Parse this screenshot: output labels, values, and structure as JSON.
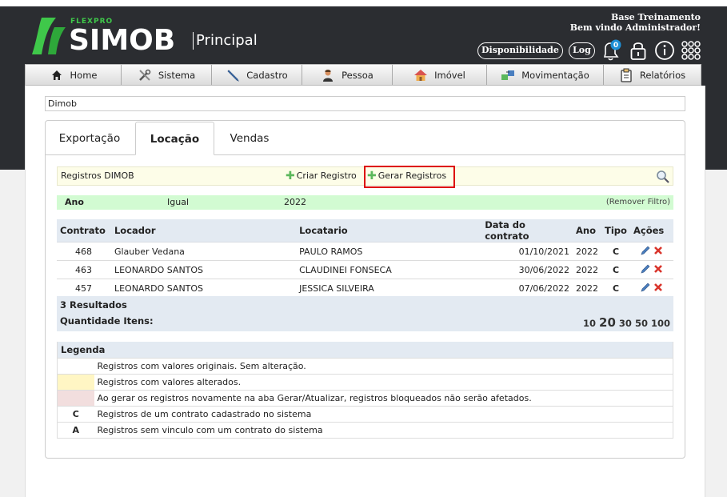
{
  "brand": {
    "flexpro": "FLEXPRO",
    "simob": "SIMOB",
    "section": "Principal"
  },
  "user": {
    "org": "Base Treinamento",
    "welcome": "Bem vindo Administrador!"
  },
  "topbar": {
    "disponibilidade": "Disponibilidade",
    "log": "Log",
    "notification_count": "0"
  },
  "menu": [
    {
      "label": "Home",
      "icon": "home-icon"
    },
    {
      "label": "Sistema",
      "icon": "tools-icon"
    },
    {
      "label": "Cadastro",
      "icon": "pencil-icon"
    },
    {
      "label": "Pessoa",
      "icon": "person-icon"
    },
    {
      "label": "Imóvel",
      "icon": "house-icon"
    },
    {
      "label": "Movimentação",
      "icon": "transfer-icon"
    },
    {
      "label": "Relatórios",
      "icon": "clipboard-icon"
    }
  ],
  "breadcrumb": "Dimob",
  "tabs": [
    {
      "label": "Exportação"
    },
    {
      "label": "Locação"
    },
    {
      "label": "Vendas"
    }
  ],
  "toolbar": {
    "title": "Registros DIMOB",
    "criar": "Criar Registro",
    "gerar": "Gerar Registros"
  },
  "filter": {
    "field": "Ano",
    "operator": "Igual",
    "value": "2022",
    "remove": "(Remover Filtro)"
  },
  "table": {
    "headers": [
      "Contrato",
      "Locador",
      "Locatario",
      "Data do contrato",
      "Ano",
      "Tipo",
      "Ações"
    ],
    "rows": [
      {
        "contrato": "468",
        "locador": "Glauber Vedana",
        "locatario": "PAULO RAMOS",
        "data": "01/10/2021",
        "ano": "2022",
        "tipo": "C"
      },
      {
        "contrato": "463",
        "locador": "LEONARDO SANTOS",
        "locatario": "CLAUDINEI FONSECA",
        "data": "30/06/2022",
        "ano": "2022",
        "tipo": "C"
      },
      {
        "contrato": "457",
        "locador": "LEONARDO SANTOS",
        "locatario": "JESSICA SILVEIRA",
        "data": "07/06/2022",
        "ano": "2022",
        "tipo": "C"
      }
    ]
  },
  "results": {
    "count": "3 Resultados",
    "qty_label": "Quantidade Itens:",
    "page_sizes": [
      "10",
      "20",
      "30",
      "50",
      "100"
    ]
  },
  "legend": {
    "title": "Legenda",
    "items": [
      {
        "symbol": "",
        "color": "#ffffff",
        "text": "Registros com valores originais. Sem alteração."
      },
      {
        "symbol": "",
        "color": "#fff6c4",
        "text": "Registros com valores alterados."
      },
      {
        "symbol": "",
        "color": "#f2dede",
        "text": "Ao gerar os registros novamente na aba Gerar/Atualizar, registros bloqueados não serão afetados."
      },
      {
        "symbol": "C",
        "color": "#ffffff",
        "text": "Registros de um contrato cadastrado no sistema"
      },
      {
        "symbol": "A",
        "color": "#ffffff",
        "text": "Registros sem vinculo com um contrato do sistema"
      }
    ]
  }
}
